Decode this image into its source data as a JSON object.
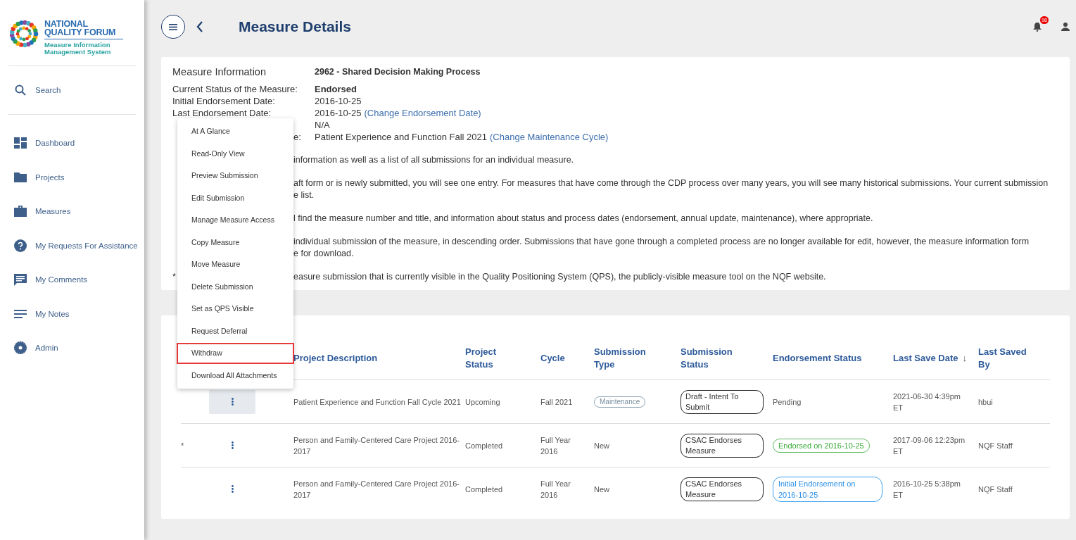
{
  "logo": {
    "line_1": "NATIONAL",
    "line_2": "QUALITY FORUM",
    "subtitle": "Measure Information Management System"
  },
  "sidebar": {
    "search": "Search",
    "items": [
      {
        "label": "Dashboard",
        "kind": "dashboard"
      },
      {
        "label": "Projects",
        "kind": "folder"
      },
      {
        "label": "Measures",
        "kind": "briefcase"
      },
      {
        "label": "My Requests For Assistance",
        "kind": "help"
      },
      {
        "label": "My Comments",
        "kind": "comment"
      },
      {
        "label": "My Notes",
        "kind": "notes"
      },
      {
        "label": "Admin",
        "kind": "gear"
      }
    ]
  },
  "header": {
    "title": "Measure Details",
    "notification_count": "98"
  },
  "measure_info": {
    "heading": "Measure Information",
    "measure_title": "2962 - Shared Decision Making Process",
    "fields": [
      {
        "label": "Current Status of the Measure:",
        "value": "Endorsed",
        "bold": true
      },
      {
        "label": "Initial Endorsement Date:",
        "value": "2016-10-25",
        "bold": false
      },
      {
        "label": "Last Endorsement Date:",
        "value": "2016-10-25",
        "link": "(Change Endorsement Date)",
        "bold": false
      },
      {
        "value": "N/A",
        "bold": false
      },
      {
        "label": "e:",
        "value": "Patient Experience and Function Fall 2021",
        "link": "(Change Maintenance Cycle)",
        "bold": false
      }
    ],
    "paragraphs": [
      {
        "lines": [
          "information as well as a list of all submissions for an individual measure."
        ]
      },
      {
        "lines": [
          "aft form or is newly submitted, you will see one entry. For measures that have come through the CDP process over many years, you will see many historical submissions. Your current submission",
          "e list."
        ]
      },
      {
        "lines": [
          "l find the measure number and title, and information about status and process dates (endorsement, annual update, maintenance), where appropriate."
        ]
      },
      {
        "lines": [
          "individual submission of the measure, in descending order. Submissions that have gone through a completed process are no longer available for edit, however, the measure information form",
          "e for download."
        ]
      },
      {
        "lead": "*",
        "lines": [
          "easure submission that is currently visible in the Quality Positioning System (QPS), the publicly-visible measure tool on the NQF website."
        ]
      }
    ]
  },
  "submissions": {
    "columns": [
      "Project Description",
      "Project Status",
      "Cycle",
      "Submission Type",
      "Submission Status",
      "Endorsement Status",
      "Last Save Date",
      "Last Saved By"
    ],
    "sort_indicator": "↓",
    "rows": [
      {
        "asterisk": "",
        "options_open": true,
        "description": "Patient Experience and Function Fall Cycle 2021",
        "project_status": "Upcoming",
        "cycle": "Fall 2021",
        "submission_type": {
          "kind": "pill",
          "text": "Maintenance"
        },
        "submission_status": "Draft - Intent To Submit",
        "endorsement": {
          "kind": "plain",
          "text": "Pending"
        },
        "last_save": "2021-06-30 4:39pm ET",
        "saved_by": "hbui"
      },
      {
        "asterisk": "*",
        "options_open": false,
        "description": "Person and Family-Centered Care Project 2016-2017",
        "project_status": "Completed",
        "cycle": "Full Year 2016",
        "submission_type": {
          "kind": "plain",
          "text": "New"
        },
        "submission_status": "CSAC Endorses Measure",
        "endorsement": {
          "kind": "endorsed",
          "text": "Endorsed on 2016-10-25"
        },
        "last_save": "2017-09-06 12:23pm ET",
        "saved_by": "NQF Staff"
      },
      {
        "asterisk": "",
        "options_open": false,
        "description": "Person and Family-Centered Care Project 2016-2017",
        "project_status": "Completed",
        "cycle": "Full Year 2016",
        "submission_type": {
          "kind": "plain",
          "text": "New"
        },
        "submission_status": "CSAC Endorses Measure",
        "endorsement": {
          "kind": "initial",
          "text": "Initial Endorsement on 2016-10-25"
        },
        "last_save": "2016-10-25 5:38pm ET",
        "saved_by": "NQF Staff"
      }
    ]
  },
  "options_menu": {
    "items": [
      {
        "label": "At A Glance",
        "highlighted": false
      },
      {
        "label": "Read-Only View",
        "highlighted": false
      },
      {
        "label": "Preview Submission",
        "highlighted": false
      },
      {
        "label": "Edit Submission",
        "highlighted": false
      },
      {
        "label": "Manage Measure Access",
        "highlighted": false
      },
      {
        "label": "Copy Measure",
        "highlighted": false
      },
      {
        "label": "Move Measure",
        "highlighted": false
      },
      {
        "label": "Delete Submission",
        "highlighted": false
      },
      {
        "label": "Set as QPS Visible",
        "highlighted": false
      },
      {
        "label": "Request Deferral",
        "highlighted": false
      },
      {
        "label": "Withdraw",
        "highlighted": true
      },
      {
        "label": "Download All Attachments",
        "highlighted": false
      }
    ]
  }
}
